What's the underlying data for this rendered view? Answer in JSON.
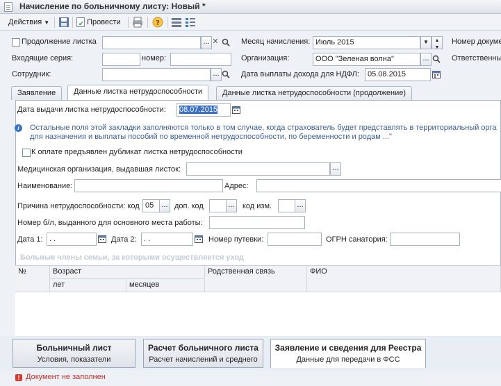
{
  "window": {
    "title": "Начисление по больничному листу: Новый *"
  },
  "toolbar": {
    "actions_label": "Действия",
    "post_label": "Провести"
  },
  "header": {
    "continuation_label": "Продолжение листка",
    "month_label": "Месяц начисления:",
    "month_value": "Июль 2015",
    "doc_number_label": "Номер докуме",
    "series_label": "Входящие серия:",
    "number_label": "номер:",
    "org_label": "Организация:",
    "org_value": "ООО \"Зеленая волна\"",
    "responsible_label": "Ответственны",
    "employee_label": "Сотрудник:",
    "ndfl_date_label": "Дата выплаты дохода для НДФЛ:",
    "ndfl_date_value": "05.08.2015"
  },
  "tabs": [
    {
      "label": "Заявление"
    },
    {
      "label": "Данные листка нетрудоспособности"
    },
    {
      "label": "Данные листка нетрудоспособности (продолжение)"
    }
  ],
  "panel": {
    "issue_date_label": "Дата выдачи листка нетрудоспособности:",
    "issue_date_value": "08.07.2015",
    "info_line1": "Остальные поля этой закладки заполняются только в том случае, когда страхователь будет представлять в территориальный орга",
    "info_line2": "для назначения и выплаты пособий по временной нетрудоспособности, по беременности и родам ...\"",
    "duplicate_label": "К оплате предъявлен дубликат листка нетрудоспособности",
    "med_org_label": "Медицинская организация, выдавшая листок:",
    "name_label": "Наименование:",
    "address_label": "Адрес:",
    "reason_label": "Причина нетрудоспособности: код",
    "reason_value": "05",
    "extra_code_label": "доп. код",
    "change_code_label": "код изм.",
    "main_work_label": "Номер б/л, выданного для основного места работы:",
    "date1_label": "Дата 1:",
    "date1_value": " .  .",
    "date2_label": "Дата 2:",
    "date2_value": " .  .",
    "voucher_label": "Номер путевки:",
    "ogrn_label": "ОГРН санатория:",
    "family_section": "Больные члены семьи, за которыми осуществляется уход"
  },
  "grid": {
    "col_num": "№",
    "col_age": "Возраст",
    "col_years": "лет",
    "col_months": "месяцев",
    "col_relation": "Родственная связь",
    "col_name": "ФИО"
  },
  "bottom_tabs": [
    {
      "title": "Больничный лист",
      "subtitle": "Условия, показатели"
    },
    {
      "title": "Расчет больничного листа",
      "subtitle": "Расчет начислений и среднего"
    },
    {
      "title": "Заявление и сведения для Реестра",
      "subtitle": "Данные для передачи в ФСС"
    }
  ],
  "status": {
    "message": "Документ не заполнен"
  },
  "colors": {
    "accent_red": "#e3262b",
    "info_blue": "#3a5e9b",
    "error_red": "#c0302a"
  },
  "icons": [
    "document-icon",
    "dropdown-arrow-icon",
    "save-icon",
    "post-icon",
    "print-icon",
    "help-icon",
    "list-icon",
    "structure-icon",
    "clear-icon",
    "search-icon",
    "calendar-icon",
    "spin-icon",
    "info-icon",
    "error-icon"
  ]
}
